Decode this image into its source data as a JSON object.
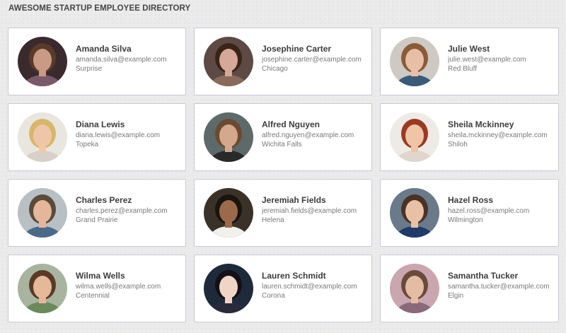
{
  "page": {
    "title": "AWESOME STARTUP EMPLOYEE DIRECTORY"
  },
  "employees": [
    {
      "name": "Amanda Silva",
      "email": "amanda.silva@example.com",
      "city": "Surprise",
      "avatar": {
        "bg": "#3a2a2e",
        "skin": "#c99a86",
        "hair": "#5b3a2a",
        "shirt": "#7a5a6a"
      }
    },
    {
      "name": "Josephine Carter",
      "email": "josephine.carter@example.com",
      "city": "Chicago",
      "avatar": {
        "bg": "#5e4a45",
        "skin": "#d6a89a",
        "hair": "#3a2418",
        "shirt": "#8a6a5a"
      }
    },
    {
      "name": "Julie West",
      "email": "julie.west@example.com",
      "city": "Red Bluff",
      "avatar": {
        "bg": "#cfc9c4",
        "skin": "#e8bfa6",
        "hair": "#8a5a3a",
        "shirt": "#3a5a7a"
      }
    },
    {
      "name": "Diana Lewis",
      "email": "diana.lewis@example.com",
      "city": "Topeka",
      "avatar": {
        "bg": "#e9e6e0",
        "skin": "#f0c6a8",
        "hair": "#d8b66a",
        "shirt": "#d8d0c8"
      }
    },
    {
      "name": "Alfred Nguyen",
      "email": "alfred.nguyen@example.com",
      "city": "Wichita Falls",
      "avatar": {
        "bg": "#5e6a6a",
        "skin": "#d4a88c",
        "hair": "#6a4a32",
        "shirt": "#2a2a2a"
      }
    },
    {
      "name": "Sheila Mckinney",
      "email": "sheila.mckinney@example.com",
      "city": "Shiloh",
      "avatar": {
        "bg": "#eeeae6",
        "skin": "#f0c4a6",
        "hair": "#9a3a22",
        "shirt": "#e0d6ce"
      }
    },
    {
      "name": "Charles Perez",
      "email": "charles.perez@example.com",
      "city": "Grand Prairie",
      "avatar": {
        "bg": "#b8c0c4",
        "skin": "#e4b69a",
        "hair": "#5a4a3a",
        "shirt": "#4a6a8a"
      }
    },
    {
      "name": "Jeremiah Fields",
      "email": "jeremiah.fields@example.com",
      "city": "Helena",
      "avatar": {
        "bg": "#3a3228",
        "skin": "#9a6a4a",
        "hair": "#1a1410",
        "shirt": "#f2f0ec"
      }
    },
    {
      "name": "Hazel Ross",
      "email": "hazel.ross@example.com",
      "city": "Wilmington",
      "avatar": {
        "bg": "#6a7a8a",
        "skin": "#e8c0a6",
        "hair": "#4a3226",
        "shirt": "#1e3a6a"
      }
    },
    {
      "name": "Wilma Wells",
      "email": "wilma.wells@example.com",
      "city": "Centennial",
      "avatar": {
        "bg": "#a8b4a0",
        "skin": "#e4b898",
        "hair": "#5a3a26",
        "shirt": "#6a8a5a"
      }
    },
    {
      "name": "Lauren Schmidt",
      "email": "lauren.schmidt@example.com",
      "city": "Corona",
      "avatar": {
        "bg": "#1e2a3a",
        "skin": "#f0d4c4",
        "hair": "#141018",
        "shirt": "#2a2a3a"
      }
    },
    {
      "name": "Samantha Tucker",
      "email": "samantha.tucker@example.com",
      "city": "Elgin",
      "avatar": {
        "bg": "#c9a6b0",
        "skin": "#e4bca4",
        "hair": "#6a4a3a",
        "shirt": "#8a6a7a"
      }
    }
  ]
}
